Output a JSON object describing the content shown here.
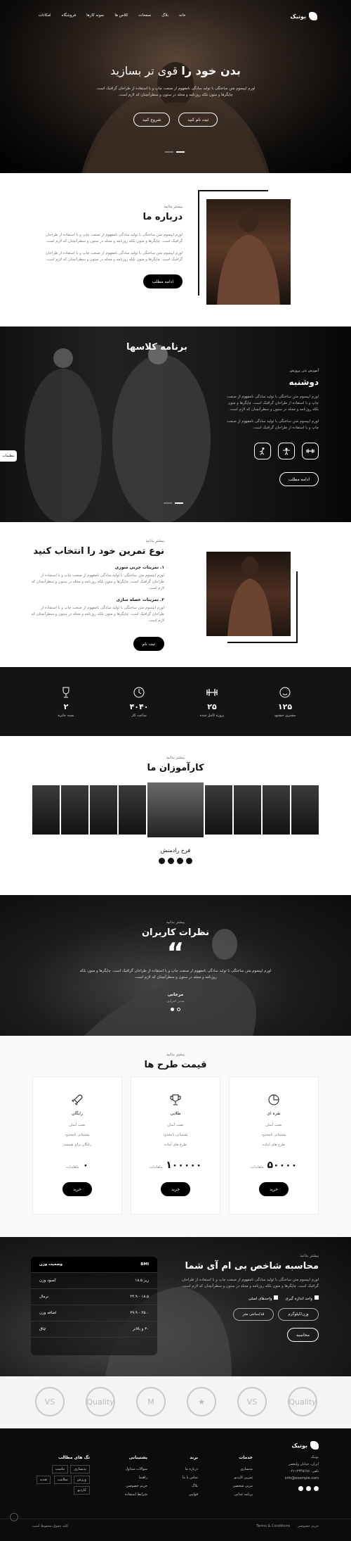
{
  "nav": {
    "logo": "بوتیک",
    "items": [
      "خانه",
      "بلاگ",
      "صفحات",
      "کلاس ها",
      "نمونه کارها",
      "فروشگاه",
      "امکانات"
    ]
  },
  "hero": {
    "title_part1": "بدن خود را",
    "title_part2": "قوی تر بسازید",
    "text": "لورم ایپسوم متن ساختگی با تولید سادگی نامفهوم از صنعت چاپ و با استفاده از طراحان گرافیک است. چاپگرها و متون بلکه روزنامه و مجله در ستون و سطرآنچنان که لازم است.",
    "btn_primary": "ثبت نام کنید",
    "btn_secondary": "شروع کنید"
  },
  "about": {
    "subtitle": "بیشتر بدانید",
    "title": "درباره ما",
    "para1": "لورم ایپسوم متن ساختگی با تولید سادگی نامفهوم از صنعت چاپ و با استفاده از طراحان گرافیک است. چاپگرها و متون بلکه روزنامه و مجله در ستون و سطرآنچنان که لازم است.",
    "para2": "لورم ایپسوم متن ساختگی با تولید سادگی نامفهوم از صنعت چاپ و با استفاده از طراحان گرافیک است. چاپگرها و متون بلکه روزنامه و مجله در ستون و سطرآنچنان که لازم است.",
    "btn": "ادامه مطلب"
  },
  "program": {
    "title": "برنامه کلاسها",
    "sub": "آموزش بدن پرورش",
    "day": "دوشنبه",
    "para1": "لورم ایپسوم متن ساختگی با تولید سادگی نامفهوم از صنعت چاپ و با استفاده از طراحان گرافیک است. چاپگرها و متون بلکه روزنامه و مجله در ستون و سطرآنچنان که لازم است.",
    "para2": "لورم ایپسوم متن ساختگی با تولید سادگی نامفهوم از صنعت چاپ و با استفاده از طراحان گرافیک است.",
    "btn": "ادامه مطلب",
    "side_tab": "تنظیمات"
  },
  "choose": {
    "subtitle": "بیشتر بدانید",
    "title": "نوع تمرین خود را انتخاب کنید",
    "item1": "۱. تمرینات چربی سوزی",
    "item1_text": "لورم ایپسوم متن ساختگی با تولید سادگی نامفهوم از صنعت چاپ و با استفاده از طراحان گرافیک است. چاپگرها و متون بلکه روزنامه و مجله در ستون و سطرآنچنان که لازم است.",
    "item2": "۲. تمرینات عضله سازی",
    "item2_text": "لورم ایپسوم متن ساختگی با تولید سادگی نامفهوم از صنعت چاپ و با استفاده از طراحان گرافیک است. چاپگرها و متون بلکه روزنامه و مجله در ستون و سطرآنچنان که لازم است.",
    "btn": "ثبت نام"
  },
  "counters": [
    {
      "num": "۱۲۵",
      "label": "مشتری خشنود"
    },
    {
      "num": "۲۵",
      "label": "پروژه کامل شده"
    },
    {
      "num": "۴۰۴۰",
      "label": "ساعت کار"
    },
    {
      "num": "۲",
      "label": "بسته جایزه"
    }
  ],
  "trainers": {
    "subtitle": "بیشتر بدانید",
    "title": "کارآموزان ما",
    "name": "فرخ رادمنش"
  },
  "reviews": {
    "subtitle": "بیشتر بدانید",
    "title": "نظرات کاربران",
    "text": "لورم ایپسوم متن ساختگی با تولید سادگی نامفهوم از صنعت چاپ و با استفاده از طراحان گرافیک است. چاپگرها و متون بلکه روزنامه و مجله در ستون و سطرآنچنان که لازم است.",
    "name": "مرجانی",
    "role": "مدیر اجرایی"
  },
  "pricing": {
    "subtitle": "بیشتر بدانید",
    "title": "قیمت طرح ها",
    "plans": [
      {
        "name": "نقره ای",
        "f1": "نصب آسان",
        "f2": "پشتیبانی نامحدود",
        "f3": "طرح های آماده",
        "price": "۵۰۰۰۰",
        "unit": "ماهانه/ت",
        "btn": "خرید"
      },
      {
        "name": "طلایی",
        "f1": "نصب آسان",
        "f2": "پشتیبانی نامحدود",
        "f3": "طرح های آماده",
        "price": "۱۰۰۰۰۰",
        "unit": "ماهانه/ت",
        "btn": "خرید"
      },
      {
        "name": "رایگان",
        "f1": "نصب آسان",
        "f2": "پشتیبانی نامحدود",
        "f3": "رایگان برای همیشه",
        "price": "۰",
        "unit": "ماهانه/ت",
        "btn": "خرید"
      }
    ]
  },
  "bmi": {
    "subtitle": "بیشتر بدانید",
    "title": "محاسبه شاخص بی ام آی شما",
    "text": "لورم ایپسوم متن ساختگی با تولید سادگی نامفهوم از صنعت چاپ و با استفاده از طراحان گرافیک است. چاپگرها و متون بلکه روزنامه و مجله در ستون و سطرآنچنان که لازم است.",
    "opt1": "واحد اندازه گیری",
    "opt2": "واحدهای اصلی",
    "field_weight": "وزن/کیلوگرم",
    "field_height": "قد/سانتی متر",
    "btn": "محاسبه",
    "table_head": [
      "BMI",
      "وضعیت وزن"
    ],
    "rows": [
      [
        "زیر ۱۸.۵",
        "کمبود وزن"
      ],
      [
        "۱۸.۵ - ۲۴.۹",
        "نرمال"
      ],
      [
        "۲۵.۰ - ۲۹.۹",
        "اضافه وزن"
      ],
      [
        "۳۰ و بالاتر",
        "چاق"
      ]
    ]
  },
  "partners": [
    "Quality",
    "VS",
    "★",
    "M",
    "Quality",
    "VS"
  ],
  "footer": {
    "logo": "بوتیک",
    "about": [
      "بوتیک",
      "ایران، خیابان ولیعصر",
      "تلفن: ۰۲۱۱۲۳۴۵۶۷۸",
      "info@example.com"
    ],
    "col1_title": "خدمات",
    "col1": [
      "بدنسازی",
      "تمرین کاردیو",
      "مربی شخصی",
      "برنامه غذایی"
    ],
    "col2_title": "برند",
    "col2": [
      "درباره ما",
      "تماس با ما",
      "بلاگ",
      "قوانین"
    ],
    "col3_title": "پشتیبانی",
    "col3": [
      "سوالات متداول",
      "راهنما",
      "حریم خصوصی",
      "شرایط استفاده"
    ],
    "col4_title": "تگ های مطالب",
    "tags": [
      "بدنسازی",
      "تناسب",
      "ورزش",
      "سلامت",
      "تغذیه",
      "کاردیو",
      "تمرین",
      "قدرت"
    ],
    "copyright": "کلیه حقوق محفوظ است",
    "terms": "Terms & Conditions",
    "privacy": "حریم خصوصی"
  }
}
